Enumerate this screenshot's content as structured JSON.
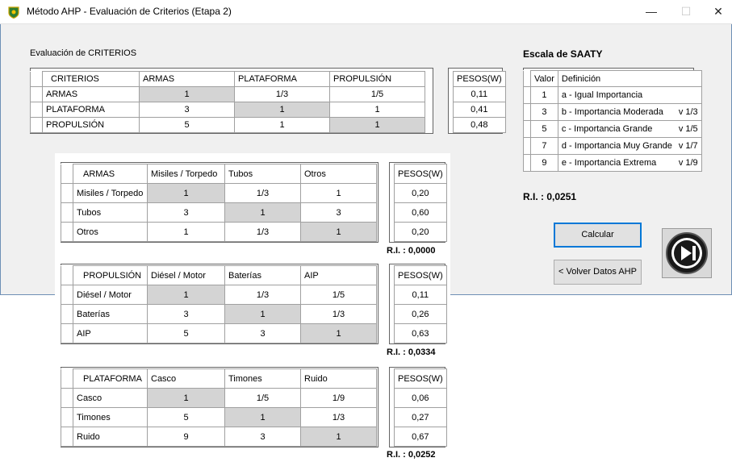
{
  "window": {
    "title": "Método AHP - Evaluación de Criterios (Etapa 2)",
    "minimize": "—",
    "maximize": "☐",
    "close": "✕"
  },
  "section_title": "Evaluación de CRITERIOS",
  "criteria": {
    "headers": [
      "CRITERIOS",
      "ARMAS",
      "PLATAFORMA",
      "PROPULSIÓN"
    ],
    "rows": [
      [
        "ARMAS",
        "1",
        "1/3",
        "1/5"
      ],
      [
        "PLATAFORMA",
        "3",
        "1",
        "1"
      ],
      [
        "PROPULSIÓN",
        "5",
        "1",
        "1"
      ]
    ],
    "weights_header": "PESOS(W)",
    "weights": [
      "0,11",
      "0,41",
      "0,48"
    ]
  },
  "saaty": {
    "title": "Escala de SAATY",
    "headers": [
      "Valor",
      "Definición"
    ],
    "rows": [
      [
        "1",
        "a - Igual Importancia",
        ""
      ],
      [
        "3",
        "b - Importancia Moderada",
        "v  1/3"
      ],
      [
        "5",
        "c - Importancia Grande",
        "v  1/5"
      ],
      [
        "7",
        "d - Importancia Muy Grande",
        "v  1/7"
      ],
      [
        "9",
        "e - Importancia Extrema",
        "v  1/9"
      ]
    ],
    "ri": "R.I. : 0,0251"
  },
  "armas": {
    "headers": [
      "ARMAS",
      "Misiles / Torpedo",
      "Tubos",
      "Otros"
    ],
    "rows": [
      [
        "Misiles / Torpedo",
        "1",
        "1/3",
        "1"
      ],
      [
        "Tubos",
        "3",
        "1",
        "3"
      ],
      [
        "Otros",
        "1",
        "1/3",
        "1"
      ]
    ],
    "weights_header": "PESOS(W)",
    "weights": [
      "0,20",
      "0,60",
      "0,20"
    ],
    "ri": "R.I. : 0,0000"
  },
  "propulsion": {
    "headers": [
      "PROPULSIÓN",
      "Diésel / Motor",
      "Baterías",
      "AIP"
    ],
    "rows": [
      [
        "Diésel / Motor",
        "1",
        "1/3",
        "1/5"
      ],
      [
        "Baterías",
        "3",
        "1",
        "1/3"
      ],
      [
        "AIP",
        "5",
        "3",
        "1"
      ]
    ],
    "weights_header": "PESOS(W)",
    "weights": [
      "0,11",
      "0,26",
      "0,63"
    ],
    "ri": "R.I. : 0,0334"
  },
  "plataforma": {
    "headers": [
      "PLATAFORMA",
      "Casco",
      "Timones",
      "Ruido"
    ],
    "rows": [
      [
        "Casco",
        "1",
        "1/5",
        "1/9"
      ],
      [
        "Timones",
        "5",
        "1",
        "1/3"
      ],
      [
        "Ruido",
        "9",
        "3",
        "1"
      ]
    ],
    "weights_header": "PESOS(W)",
    "weights": [
      "0,06",
      "0,27",
      "0,67"
    ],
    "ri": "R.I. : 0,0252"
  },
  "buttons": {
    "calcular": "Calcular",
    "volver": "< Volver Datos AHP"
  },
  "colors": {
    "diagonal_cell": "#d4d4d4",
    "focus_border": "#0078d7",
    "window_border": "#6e8fb5"
  },
  "icons": {
    "app": "shield-icon",
    "next": "skip-forward-icon"
  }
}
